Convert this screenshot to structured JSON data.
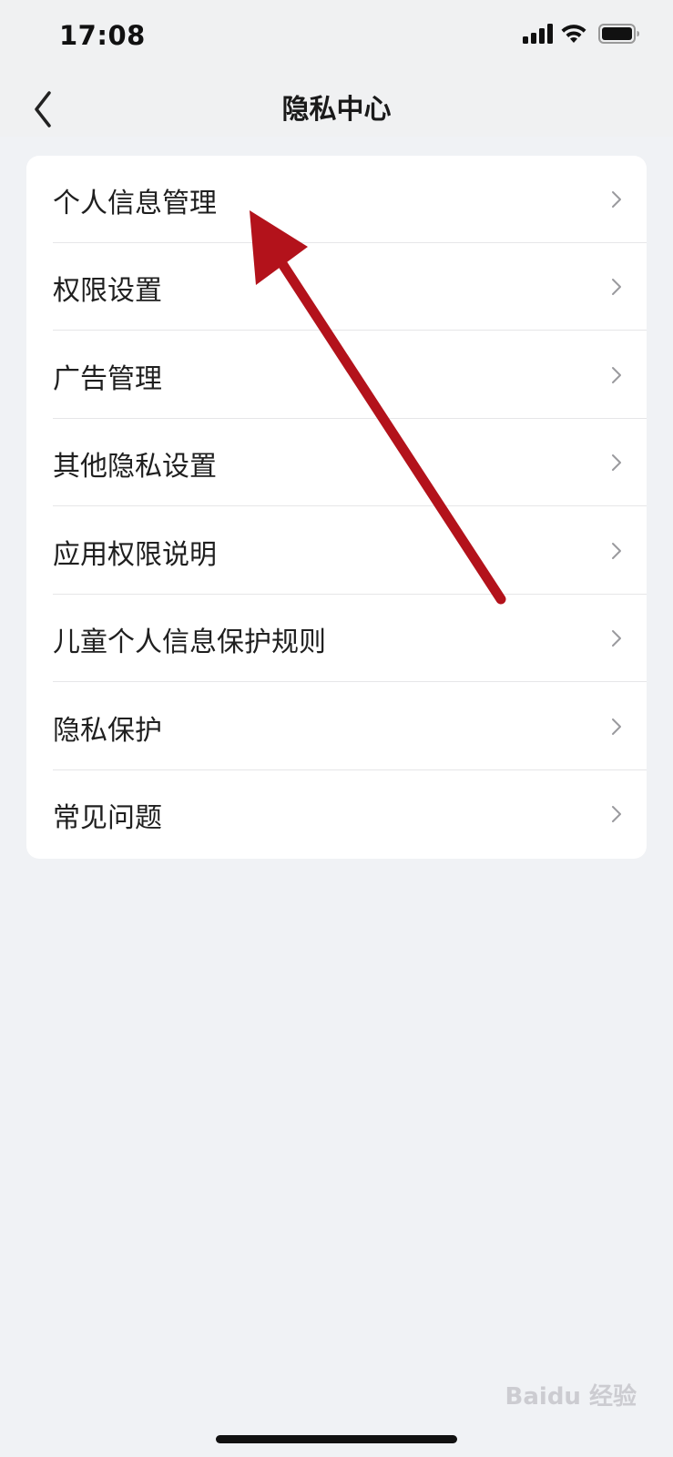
{
  "status_bar": {
    "time": "17:08"
  },
  "nav": {
    "title": "隐私中心"
  },
  "menu": {
    "items": [
      {
        "label": "个人信息管理"
      },
      {
        "label": "权限设置"
      },
      {
        "label": "广告管理"
      },
      {
        "label": "其他隐私设置"
      },
      {
        "label": "应用权限说明"
      },
      {
        "label": "儿童个人信息保护规则"
      },
      {
        "label": "隐私保护"
      },
      {
        "label": "常见问题"
      }
    ]
  },
  "watermark": {
    "text": "Baidu 经验"
  },
  "colors": {
    "annotation_arrow": "#b3121b",
    "background": "#f0f2f5",
    "card": "#ffffff"
  },
  "icons": [
    "chevron-left-icon",
    "signal-icon",
    "wifi-icon",
    "battery-icon",
    "chevron-right-icon"
  ]
}
